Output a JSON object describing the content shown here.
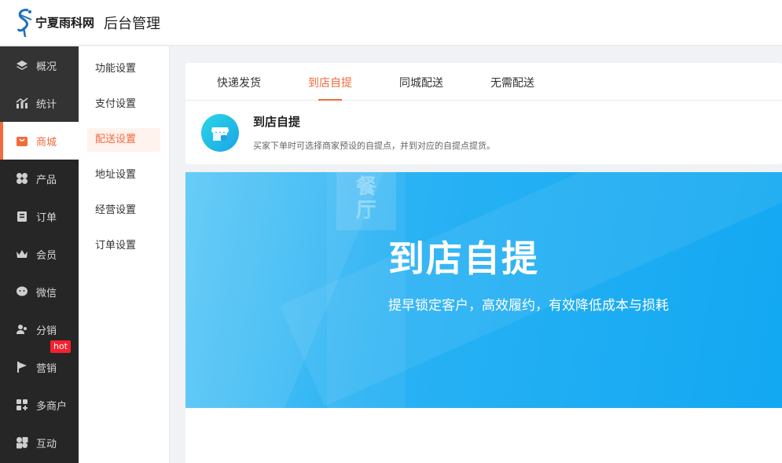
{
  "header": {
    "logo_text": "宁夏雨科网",
    "title": "后台管理"
  },
  "sidebar": {
    "items": [
      {
        "label": "概况",
        "icon": "layers-icon"
      },
      {
        "label": "统计",
        "icon": "chart-icon"
      },
      {
        "label": "商城",
        "icon": "shop-bag-icon",
        "active": true
      },
      {
        "label": "产品",
        "icon": "grid-icon"
      },
      {
        "label": "订单",
        "icon": "clipboard-icon"
      },
      {
        "label": "会员",
        "icon": "crown-icon"
      },
      {
        "label": "微信",
        "icon": "wechat-icon"
      },
      {
        "label": "分销",
        "icon": "users-icon"
      },
      {
        "label": "营销",
        "icon": "flag-icon",
        "badge": "hot"
      },
      {
        "label": "多商户",
        "icon": "store-plus-icon"
      },
      {
        "label": "互动",
        "icon": "apps-icon"
      }
    ]
  },
  "submenu": {
    "items": [
      "功能设置",
      "支付设置",
      "配送设置",
      "地址设置",
      "经营设置",
      "订单设置"
    ],
    "active": "配送设置"
  },
  "tabs": {
    "items": [
      "快递发货",
      "到店自提",
      "同城配送",
      "无需配送"
    ],
    "active": "到店自提"
  },
  "info": {
    "title": "到店自提",
    "desc": "买家下单时可选择商家预设的自提点，并到对应的自提点提货。"
  },
  "banner": {
    "sign": "餐厅",
    "title": "到店自提",
    "subtitle": "提早锁定客户，高效履约，有效降低成本与损耗"
  },
  "colors": {
    "accent": "#f26a3d",
    "sidebar_bg": "#262626",
    "banner_blue": "#12a8f2",
    "hot_badge": "#f5222d"
  }
}
